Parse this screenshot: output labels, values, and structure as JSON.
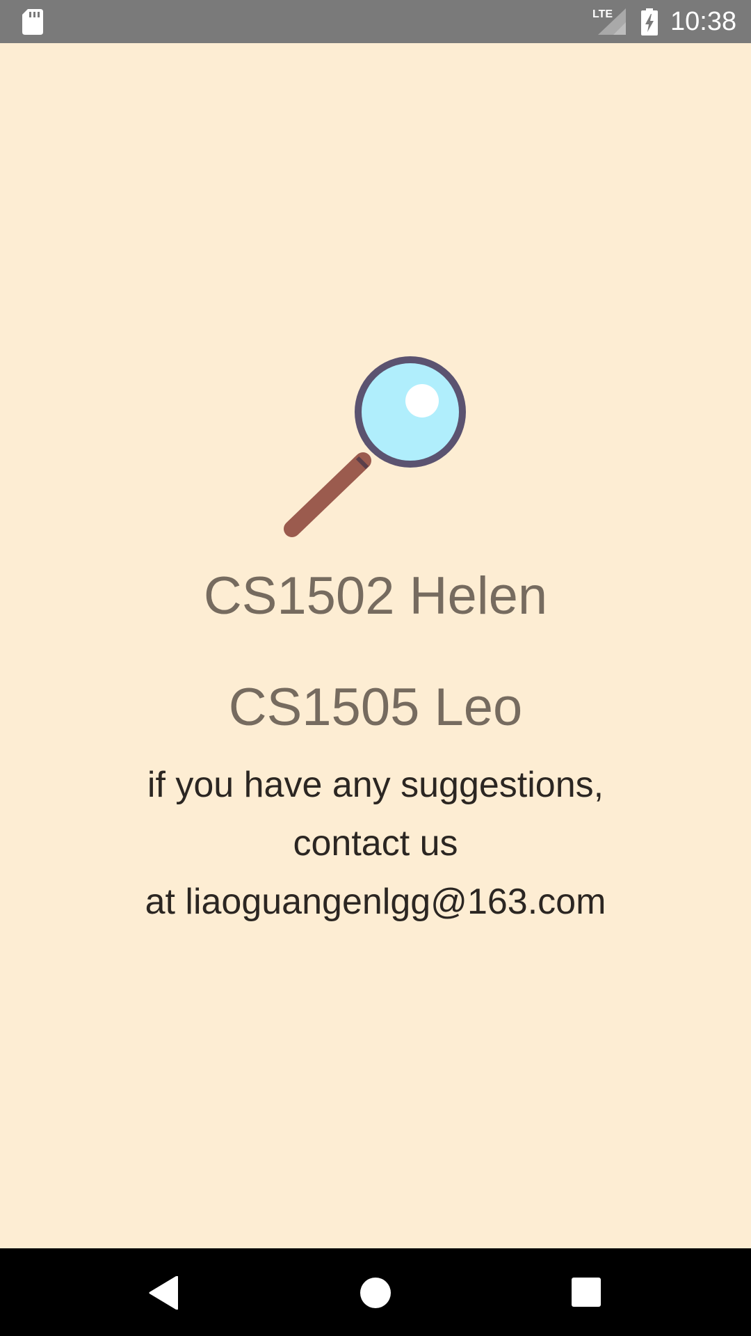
{
  "status_bar": {
    "network_label": "LTE",
    "time": "10:38",
    "icons": [
      "sd-card-icon",
      "signal-icon",
      "battery-charging-icon"
    ],
    "background_color": "#7a7a7a"
  },
  "main": {
    "icon": "magnifying-glass-icon",
    "names": [
      "CS1502 Helen",
      "CS1505 Leo"
    ],
    "contact_lines": [
      "if you have any suggestions,",
      "contact us",
      "at liaoguangenlgg@163.com"
    ],
    "background_color": "#fdedd3",
    "name_color": "#766b5f",
    "contact_color": "#2b2622"
  },
  "nav_bar": {
    "buttons": [
      "back-icon",
      "home-icon",
      "recents-icon"
    ],
    "background_color": "#000000"
  }
}
